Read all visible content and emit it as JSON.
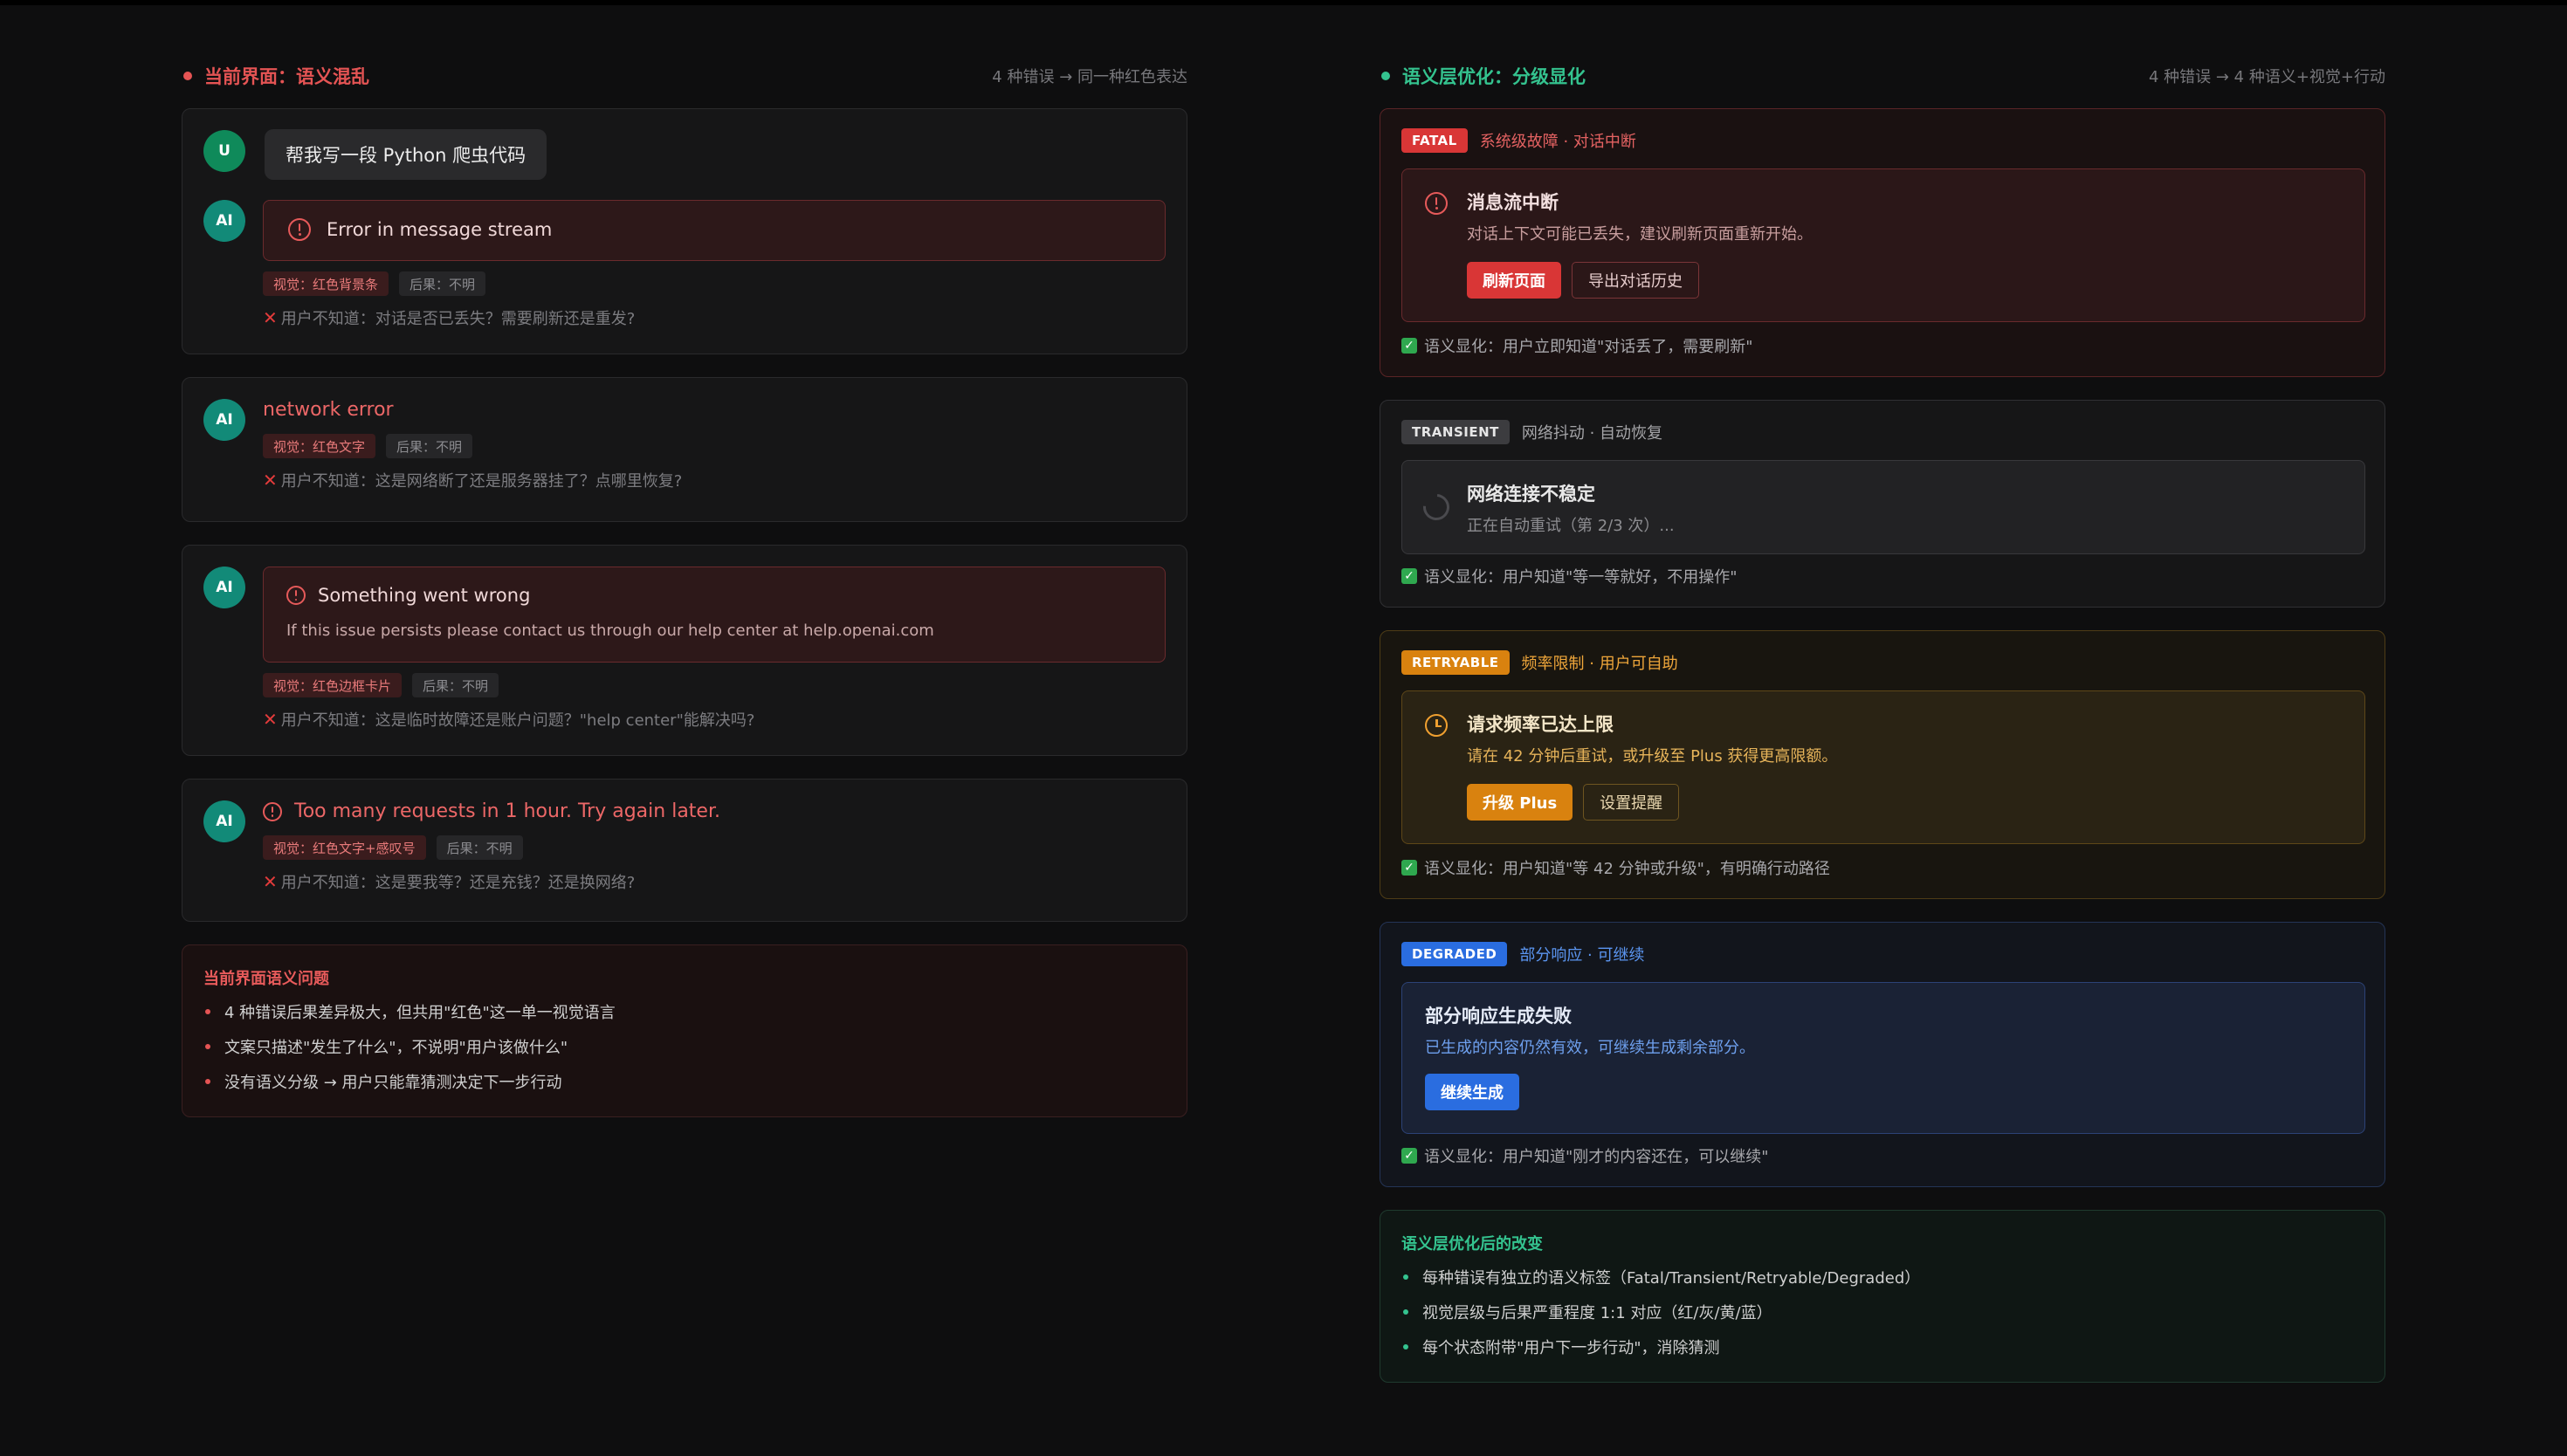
{
  "left": {
    "title": "当前界面：语义混乱",
    "subtitle": "4 种错误 → 同一种红色表达",
    "user_avatar": "U",
    "ai_avatar": "AI",
    "user_message": "帮我写一段 Python 爬虫代码",
    "cards": [
      {
        "message": "Error in message stream",
        "chip_visual": "视觉：红色背景条",
        "chip_outcome": "后果：不明",
        "note": "用户不知道：对话是否已丢失？需要刷新还是重发?"
      },
      {
        "message": "network error",
        "chip_visual": "视觉：红色文字",
        "chip_outcome": "后果：不明",
        "note": "用户不知道：这是网络断了还是服务器挂了？点哪里恢复?"
      },
      {
        "message": "Something went wrong",
        "detail": "If this issue persists please contact us through our help center at help.openai.com",
        "chip_visual": "视觉：红色边框卡片",
        "chip_outcome": "后果：不明",
        "note": "用户不知道：这是临时故障还是账户问题？\"help center\"能解决吗?"
      },
      {
        "message": "Too many requests in 1 hour. Try again later.",
        "chip_visual": "视觉：红色文字+感叹号",
        "chip_outcome": "后果：不明",
        "note": "用户不知道：这是要我等？还是充钱？还是换网络?"
      }
    ],
    "summary": {
      "title": "当前界面语义问题",
      "items": [
        "4 种错误后果差异极大，但共用\"红色\"这一单一视觉语言",
        "文案只描述\"发生了什么\"，不说明\"用户该做什么\"",
        "没有语义分级 → 用户只能靠猜测决定下一步行动"
      ]
    }
  },
  "right": {
    "title": "语义层优化：分级显化",
    "subtitle": "4 种错误 → 4 种语义+视觉+行动",
    "fatal": {
      "tag": "FATAL",
      "tag_desc": "系统级故障 · 对话中断",
      "title": "消息流中断",
      "desc": "对话上下文可能已丢失，建议刷新页面重新开始。",
      "btn_primary": "刷新页面",
      "btn_secondary": "导出对话历史",
      "check": "语义显化：用户立即知道\"对话丢了，需要刷新\""
    },
    "transient": {
      "tag": "TRANSIENT",
      "tag_desc": "网络抖动 · 自动恢复",
      "title": "网络连接不稳定",
      "desc": "正在自动重试（第 2/3 次）...",
      "check": "语义显化：用户知道\"等一等就好，不用操作\""
    },
    "retryable": {
      "tag": "RETRYABLE",
      "tag_desc": "频率限制 · 用户可自助",
      "title": "请求频率已达上限",
      "desc": "请在 42 分钟后重试，或升级至 Plus 获得更高限额。",
      "btn_primary": "升级 Plus",
      "btn_secondary": "设置提醒",
      "check": "语义显化：用户知道\"等 42 分钟或升级\"，有明确行动路径"
    },
    "degraded": {
      "tag": "DEGRADED",
      "tag_desc": "部分响应 · 可继续",
      "title": "部分响应生成失败",
      "desc": "已生成的内容仍然有效，可继续生成剩余部分。",
      "btn_primary": "继续生成",
      "check": "语义显化：用户知道\"刚才的内容还在，可以继续\""
    },
    "summary": {
      "title": "语义层优化后的改变",
      "items": [
        "每种错误有独立的语义标签（Fatal/Transient/Retryable/Degraded）",
        "视觉层级与后果严重程度 1:1 对应（红/灰/黄/蓝）",
        "每个状态附带\"用户下一步行动\"，消除猜测"
      ]
    }
  },
  "colors": {
    "fatal": "#d93636",
    "transient": "#3a3a3c",
    "retryable": "#d9820f",
    "degraded": "#2a6de0",
    "left_accent": "#e55454",
    "right_accent": "#34c38f"
  }
}
